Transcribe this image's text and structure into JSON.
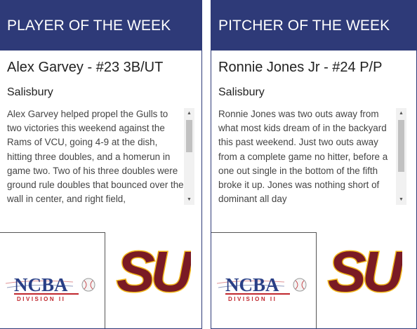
{
  "player_card": {
    "header": "PLAYER OF THE WEEK",
    "name": "Alex Garvey - #23 3B/UT",
    "school": "Salisbury",
    "bio": "Alex Garvey helped propel the Gulls to two victories this weekend against the Rams of VCU, going 4-9 at the dish, hitting three doubles, and a homerun in game two. Two of his three doubles were ground rule doubles that bounced over the wall in center, and right field,"
  },
  "pitcher_card": {
    "header": "PITCHER OF THE WEEK",
    "name": "Ronnie Jones Jr - #24 P/P",
    "school": "Salisbury",
    "bio": "Ronnie Jones was two outs away from what most kids dream of in the backyard this past weekend. Just two outs away from a complete game no hitter, before a one out single in the bottom of the fifth broke it up. Jones was nothing short of dominant all day"
  },
  "logos": {
    "ncba_text": "NCBA",
    "ncba_division": "DIVISION II",
    "su_text": "SU"
  },
  "colors": {
    "header_bg": "#2e3a78",
    "su_maroon": "#7a1a24",
    "su_gold": "#f2b81b",
    "ncba_blue": "#2a3f86",
    "ncba_red": "#c0272d"
  }
}
